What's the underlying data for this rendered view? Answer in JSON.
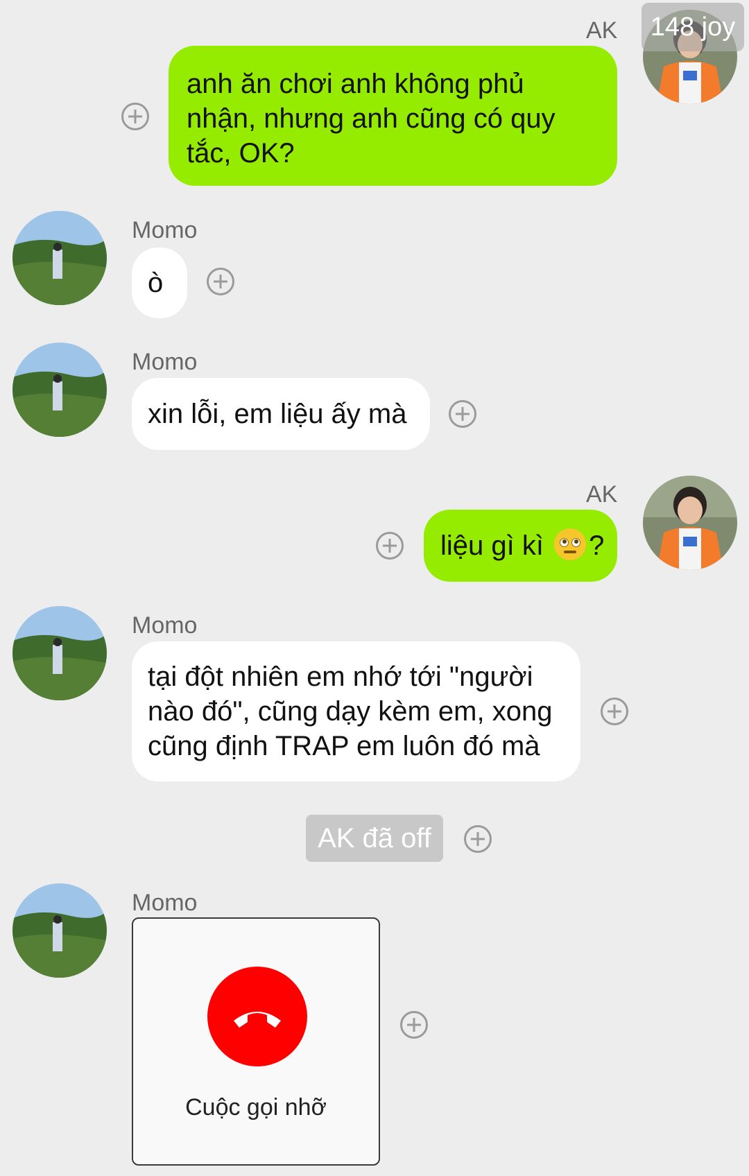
{
  "top_counter": "148 joy",
  "participants": {
    "me": "AK",
    "other": "Momo"
  },
  "messages": [
    {
      "sender": "AK",
      "lines": [
        "anh ăn chơi anh không phủ",
        "nhận, nhưng anh cũng có quy",
        "tắc, OK?"
      ]
    },
    {
      "sender": "Momo",
      "lines": [
        "ò"
      ]
    },
    {
      "sender": "Momo",
      "lines": [
        "xin lỗi, em liệu ấy mà"
      ]
    },
    {
      "sender": "AK",
      "text_before": "liệu gì kì ",
      "text_after": "?",
      "emoji": "face-with-rolling-eyes-icon"
    },
    {
      "sender": "Momo",
      "lines": [
        "tại đột nhiên em nhớ tới \"người",
        "nào đó\", cũng dạy kèm em, xong",
        "cũng định TRAP em luôn đó mà"
      ]
    }
  ],
  "system_notice": "AK đã off",
  "call": {
    "sender": "Momo",
    "label": "Cuộc gọi nhỡ",
    "icon": "hang-up-phone-icon"
  },
  "colors": {
    "background": "#ededed",
    "outgoing_bubble": "#95ec00",
    "incoming_bubble": "#ffffff",
    "missed_call": "#fe0000"
  }
}
